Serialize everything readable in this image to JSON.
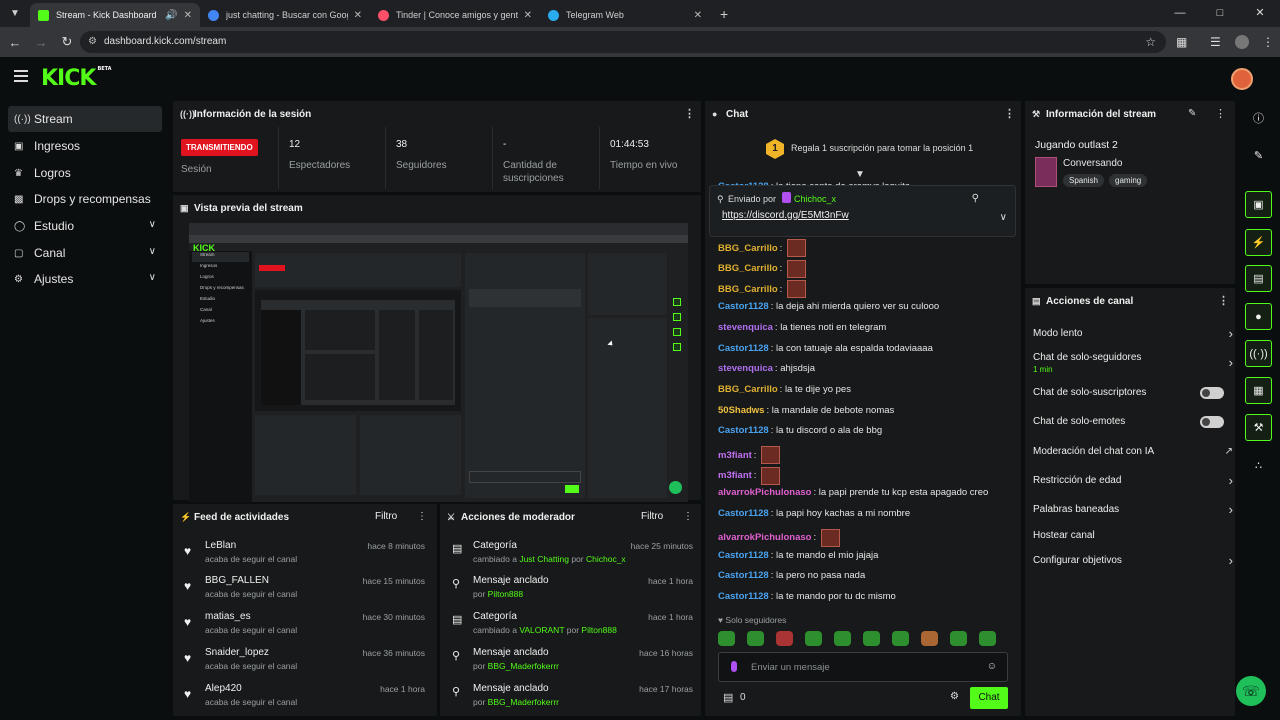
{
  "browser": {
    "tabs": [
      {
        "title": "Stream - Kick Dashboard",
        "color": "#53fc18"
      },
      {
        "title": "just chatting - Buscar con Goog",
        "color": "#4285f4"
      },
      {
        "title": "Tinder | Conoce amigos y gente",
        "color": "#fd5068"
      },
      {
        "title": "Telegram Web",
        "color": "#2aabee"
      }
    ],
    "url": "dashboard.kick.com/stream"
  },
  "brand": {
    "logo": "KICK",
    "beta": "BETA",
    "accent": "#53fc18"
  },
  "sidebar": {
    "items": [
      {
        "label": "Stream",
        "icon": "broadcast-icon"
      },
      {
        "label": "Ingresos",
        "icon": "wallet-icon"
      },
      {
        "label": "Logros",
        "icon": "trophy-icon"
      },
      {
        "label": "Drops y recompensas",
        "icon": "gift-icon"
      },
      {
        "label": "Estudio",
        "icon": "studio-icon"
      },
      {
        "label": "Canal",
        "icon": "channel-icon"
      },
      {
        "label": "Ajustes",
        "icon": "gear-icon"
      }
    ]
  },
  "session": {
    "title": "Información de la sesión",
    "live_badge": "TRANSMITIENDO",
    "live_label": "Sesión",
    "stats": [
      {
        "value": "12",
        "label": "Espectadores"
      },
      {
        "value": "38",
        "label": "Seguidores"
      },
      {
        "value": "-",
        "label": "Cantidad de suscripciones"
      },
      {
        "value": "01:44:53",
        "label": "Tiempo en vivo"
      }
    ]
  },
  "preview": {
    "title": "Vista previa del stream"
  },
  "activity": {
    "title": "Feed de actividades",
    "filter": "Filtro",
    "rows": [
      {
        "name": "LeBlan",
        "sub": "acaba de seguir el canal",
        "time": "hace 8 minutos"
      },
      {
        "name": "BBG_FALLEN",
        "sub": "acaba de seguir el canal",
        "time": "hace 15 minutos"
      },
      {
        "name": "matias_es",
        "sub": "acaba de seguir el canal",
        "time": "hace 30 minutos"
      },
      {
        "name": "Snaider_lopez",
        "sub": "acaba de seguir el canal",
        "time": "hace 36 minutos"
      },
      {
        "name": "Alep420",
        "sub": "acaba de seguir el canal",
        "time": "hace 1 hora"
      }
    ]
  },
  "mod": {
    "title": "Acciones de moderador",
    "filter": "Filtro",
    "rows": [
      {
        "title": "Categoría",
        "pre": "cambiado a",
        "hl1": "Just Chatting",
        "mid": "por",
        "hl2": "Chichoc_x",
        "time": "hace 25 minutos"
      },
      {
        "title": "Mensaje anclado",
        "pre": "por",
        "hl1": "Pilton888",
        "mid": "",
        "hl2": "",
        "time": "hace 1 hora"
      },
      {
        "title": "Categoría",
        "pre": "cambiado a",
        "hl1": "VALORANT",
        "mid": "por",
        "hl2": "Pilton888",
        "time": "hace 1 hora"
      },
      {
        "title": "Mensaje anclado",
        "pre": "por",
        "hl1": "BBG_Maderfokerrr",
        "mid": "",
        "hl2": "",
        "time": "hace 16 horas"
      },
      {
        "title": "Mensaje anclado",
        "pre": "por",
        "hl1": "BBG_Maderfokerrr",
        "mid": "",
        "hl2": "",
        "time": "hace 17 horas"
      }
    ]
  },
  "chat": {
    "title": "Chat",
    "gift_number": "1",
    "gift_text": "Regala 1 suscripción para tomar la posición 1",
    "partial_user": "Castor1128",
    "partial_text": "la tiene canta de aremys loquita",
    "pinned_by": "Enviado por",
    "pinned_user": "Chichoc_x",
    "pinned_link": "https://discord.gg/E5Mt3nFw",
    "messages": [
      {
        "user": "BBG_Carrillo",
        "color": "#e0b030",
        "text": "",
        "emote": true
      },
      {
        "user": "BBG_Carrillo",
        "color": "#e0b030",
        "text": "",
        "emote": true
      },
      {
        "user": "BBG_Carrillo",
        "color": "#e0b030",
        "text": "",
        "emote": true
      },
      {
        "user": "Castor1128",
        "color": "#4aa3f0",
        "text": "la deja ahi mierda quiero ver su culooo",
        "emote": false
      },
      {
        "user": "stevenquica",
        "color": "#b070f0",
        "text": "la tienes noti en telegram",
        "emote": false
      },
      {
        "user": "Castor1128",
        "color": "#4aa3f0",
        "text": "la con tatuaje ala espalda todaviaaaa",
        "emote": false
      },
      {
        "user": "stevenquica",
        "color": "#b070f0",
        "text": "ahjsdsja",
        "emote": false
      },
      {
        "user": "BBG_Carrillo",
        "color": "#e0b030",
        "text": "la te dije yo pes",
        "emote": false
      },
      {
        "user": "50Shadws",
        "color": "#f0c040",
        "text": "la mandale de bebote nomas",
        "emote": false
      },
      {
        "user": "Castor1128",
        "color": "#4aa3f0",
        "text": "la tu discord o ala de bbg",
        "emote": false
      },
      {
        "user": "m3fiant",
        "color": "#c070f0",
        "text": "",
        "emote": true
      },
      {
        "user": "m3fiant",
        "color": "#c070f0",
        "text": "",
        "emote": true
      },
      {
        "user": "alvarrokPichulonaso",
        "color": "#e060d0",
        "text": "la papi prende tu kcp esta apagado creo",
        "emote": false
      },
      {
        "user": "Castor1128",
        "color": "#4aa3f0",
        "text": "la papi hoy kachas a mi nombre",
        "emote": false
      },
      {
        "user": "alvarrokPichulonaso",
        "color": "#e060d0",
        "text": "",
        "emote": true
      },
      {
        "user": "Castor1128",
        "color": "#4aa3f0",
        "text": "la te mando el mio jajaja",
        "emote": false
      },
      {
        "user": "Castor1128",
        "color": "#4aa3f0",
        "text": "la pero no pasa nada",
        "emote": false
      },
      {
        "user": "Castor1128",
        "color": "#4aa3f0",
        "text": "la te mando por tu dc mismo",
        "emote": false
      }
    ],
    "followers_only": "Solo seguidores",
    "input_placeholder": "Enviar un mensaje",
    "points": "0",
    "send_label": "Chat"
  },
  "stream_info": {
    "title": "Información del stream",
    "stream_title": "Jugando outlast 2",
    "category": "Conversando",
    "tags": [
      "Spanish",
      "gaming"
    ]
  },
  "channel_actions": {
    "title": "Acciones de canal",
    "items": [
      {
        "label": "Modo lento",
        "sub": "",
        "control": "chevron"
      },
      {
        "label": "Chat de solo-seguidores",
        "sub": "1 min",
        "control": "chevron"
      },
      {
        "label": "Chat de solo-suscriptores",
        "sub": "",
        "control": "toggle"
      },
      {
        "label": "Chat de solo-emotes",
        "sub": "",
        "control": "toggle"
      },
      {
        "label": "Moderación del chat con IA",
        "sub": "",
        "control": "external"
      },
      {
        "label": "Restricción de edad",
        "sub": "",
        "control": "chevron"
      },
      {
        "label": "Palabras baneadas",
        "sub": "",
        "control": "chevron"
      },
      {
        "label": "Hostear canal",
        "sub": "",
        "control": "none"
      },
      {
        "label": "Configurar objetivos",
        "sub": "",
        "control": "chevron"
      }
    ]
  }
}
